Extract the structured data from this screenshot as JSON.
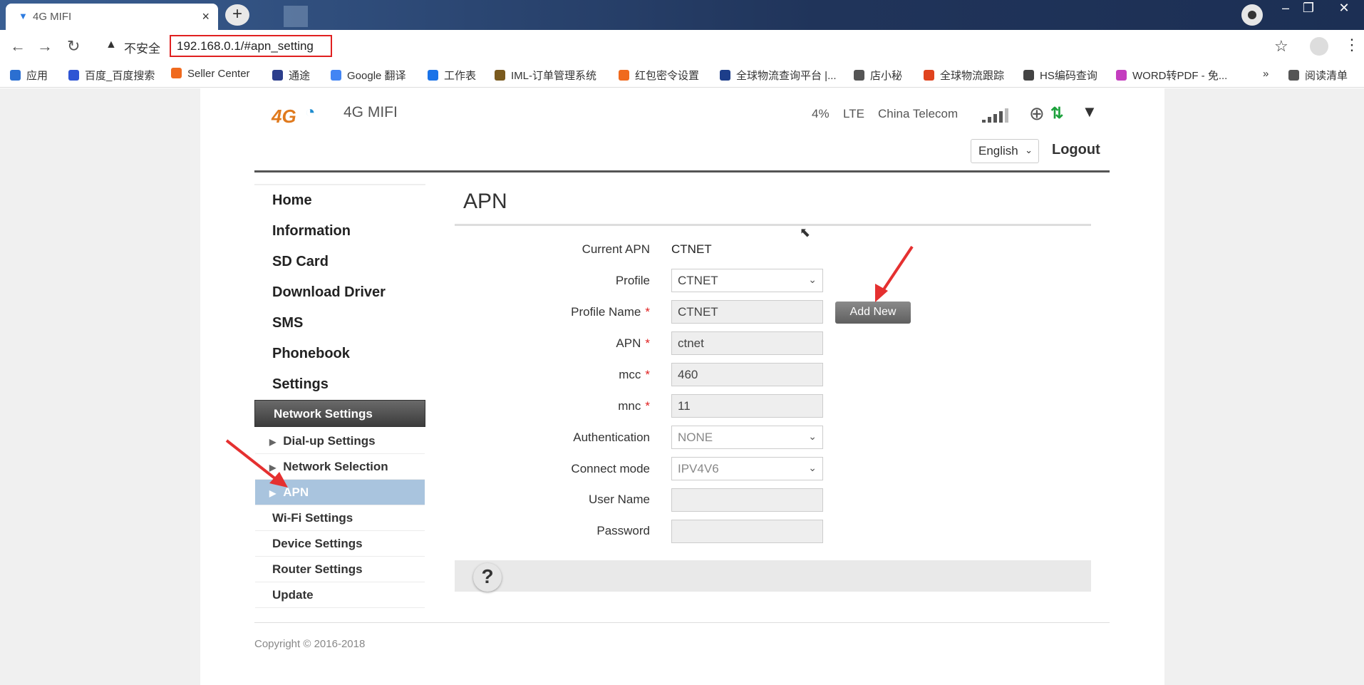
{
  "browser": {
    "tab_title": "4G MIFI",
    "tab_close": "×",
    "new_tab": "+",
    "security_label": "不安全",
    "url": "192.168.0.1/#apn_setting",
    "bookmarks": [
      {
        "label": "应用",
        "color": "#2b6fd1"
      },
      {
        "label": "百度_百度搜索",
        "color": "#2f55d4"
      },
      {
        "label": "Seller Center",
        "color": "#f06a1e"
      },
      {
        "label": "通途",
        "color": "#2c3e8c"
      },
      {
        "label": "Google 翻译",
        "color": "#4285f4"
      },
      {
        "label": "工作表",
        "color": "#1a73e8"
      },
      {
        "label": "IML-订单管理系统",
        "color": "#7a5a1e"
      },
      {
        "label": "红包密令设置",
        "color": "#f06a1e"
      },
      {
        "label": "全球物流查询平台 |...",
        "color": "#1d3e8a"
      },
      {
        "label": "店小秘",
        "color": "#555555"
      },
      {
        "label": "全球物流跟踪",
        "color": "#e0431e"
      },
      {
        "label": "HS编码查询",
        "color": "#444444"
      },
      {
        "label": "WORD转PDF - 免...",
        "color": "#c43dbf"
      },
      {
        "label": "»",
        "color": ""
      },
      {
        "label": "阅读清单",
        "color": "#555555"
      }
    ]
  },
  "header": {
    "logo_text": "4G",
    "brand": "4G MIFI",
    "battery": "4%",
    "network_type": "LTE",
    "carrier": "China Telecom",
    "language": "English",
    "logout": "Logout"
  },
  "menu": {
    "items": [
      "Home",
      "Information",
      "SD Card",
      "Download Driver",
      "SMS",
      "Phonebook",
      "Settings"
    ],
    "section": "Network Settings",
    "sub_items": [
      "Dial-up Settings",
      "Network Selection",
      "APN"
    ],
    "other_items": [
      "Wi-Fi Settings",
      "Device Settings",
      "Router Settings",
      "Update"
    ]
  },
  "apn": {
    "title": "APN",
    "current_apn_label": "Current APN",
    "current_apn_value": "CTNET",
    "profile_label": "Profile",
    "profile_value": "CTNET",
    "profile_name_label": "Profile Name",
    "profile_name_value": "CTNET",
    "apn_label": "APN",
    "apn_value": "ctnet",
    "mcc_label": "mcc",
    "mcc_value": "460",
    "mnc_label": "mnc",
    "mnc_value": "11",
    "auth_label": "Authentication",
    "auth_value": "NONE",
    "connect_label": "Connect mode",
    "connect_value": "IPV4V6",
    "username_label": "User Name",
    "username_value": "",
    "password_label": "Password",
    "password_value": "",
    "required_mark": "*",
    "add_new": "Add New",
    "help": "?"
  },
  "footer": {
    "copyright": "Copyright © 2016-2018"
  }
}
